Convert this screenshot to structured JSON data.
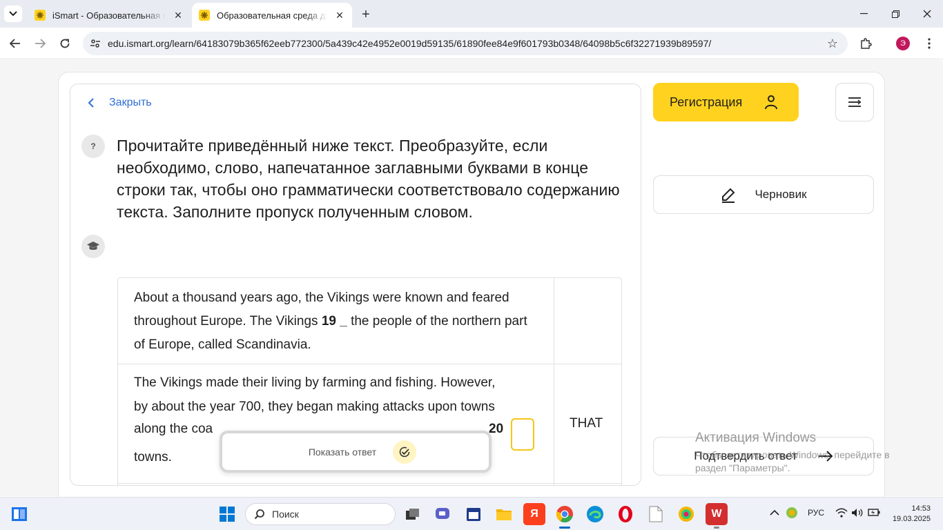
{
  "browser": {
    "tabs": [
      {
        "title": "iSmart - Образовательная пла",
        "active": false
      },
      {
        "title": "Образовательная среда для сам",
        "active": true
      }
    ],
    "new_tab_label": "+",
    "url": "edu.ismart.org/learn/64183079b365f62eeb772300/5a439c42e4952e0019d59135/61890fee84e9f601793b0348/64098b5c6f32271939b89597/",
    "profile_initial": "Э"
  },
  "page": {
    "close_label": "Закрыть",
    "question_badge": "?",
    "instruction": "Прочитайте приведённый ниже текст. Преобразуйте, если необходимо, слово, напечатанное заглавными буквами в конце строки так, чтобы оно грамматически соответствовало содержанию текста. Заполните пропуск полученным словом.",
    "row1": {
      "text_before": "About a thousand years ago, the Vikings were known and feared throughout Europe. The Vikings ",
      "gap_number": "19 _",
      "text_after": " the people of the northern part of Europe, called Scandinavia."
    },
    "row2": {
      "line1": "The Vikings made their living by farming and fishing. However,",
      "line2": "by about the year 700, they began making attacks upon towns",
      "line3": "along the coa",
      "gap_number": "20",
      "line4": "towns.",
      "answer_value": "",
      "keyword": "THAT"
    },
    "show_answer_label": "Показать ответ"
  },
  "sidebar": {
    "register_label": "Регистрация",
    "draft_label": "Черновик",
    "confirm_label": "Подтвердить ответ"
  },
  "watermark": {
    "line1": "Активация Windows",
    "line2": "Чтобы активировать Windows, перейдите в раздел \"Параметры\"."
  },
  "taskbar": {
    "search_label": "Поиск",
    "language": "РУС",
    "time": "14:53",
    "date": "19.03.2025"
  },
  "colors": {
    "accent_yellow": "#ffd21f",
    "link_blue": "#2f6fd6",
    "input_border": "#f5c518"
  }
}
